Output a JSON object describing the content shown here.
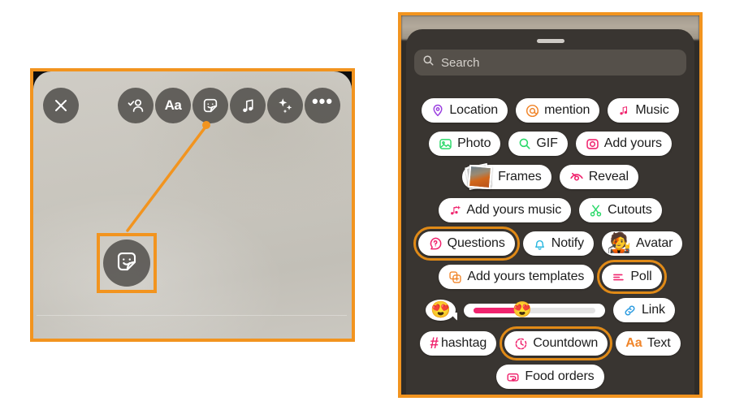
{
  "left_panel": {
    "name": "story-editor-screenshot",
    "toolbar": [
      {
        "id": "close",
        "icon": "close-icon",
        "label": "Close"
      },
      {
        "id": "tag",
        "icon": "tag-people-icon",
        "label": "Tag people"
      },
      {
        "id": "text",
        "icon": "text-icon",
        "label": "Aa"
      },
      {
        "id": "sticker",
        "icon": "sticker-icon",
        "label": "Stickers"
      },
      {
        "id": "music",
        "icon": "music-note-icon",
        "label": "Music"
      },
      {
        "id": "effects",
        "icon": "sparkles-icon",
        "label": "Effects"
      },
      {
        "id": "more",
        "icon": "more-options-icon",
        "label": "More"
      }
    ],
    "callout": {
      "name": "sticker-button-callout",
      "icon": "sticker-icon",
      "highlight_color": "#F2941F"
    }
  },
  "right_panel": {
    "name": "sticker-tray-sheet",
    "search": {
      "placeholder": "Search",
      "value": "",
      "icon": "search-icon"
    },
    "highlight_color": "#E08A17",
    "rows": [
      [
        {
          "label": "Location",
          "icon": "location-pin-icon",
          "icon_color": "#9B3FE0",
          "highlighted": false
        },
        {
          "label": "mention",
          "icon": "at-mention-icon",
          "icon_color": "#F0852A",
          "highlighted": false
        },
        {
          "label": "Music",
          "icon": "music-note-icon",
          "icon_color": "#F0246E",
          "highlighted": false
        }
      ],
      [
        {
          "label": "Photo",
          "icon": "photo-icon",
          "icon_color": "#2BD96A",
          "highlighted": false
        },
        {
          "label": "GIF",
          "icon": "gif-search-icon",
          "icon_color": "#2BD96A",
          "highlighted": false
        },
        {
          "label": "Add yours",
          "icon": "camera-icon",
          "icon_color": "#F0246E",
          "highlighted": false
        }
      ],
      [
        {
          "label": "Frames",
          "icon": "frames-photos-icon",
          "icon_color": "",
          "highlighted": false
        },
        {
          "label": "Reveal",
          "icon": "eye-slash-icon",
          "icon_color": "#F0246E",
          "highlighted": false
        }
      ],
      [
        {
          "label": "Add yours music",
          "icon": "music-plus-icon",
          "icon_color": "#F0246E",
          "highlighted": false
        },
        {
          "label": "Cutouts",
          "icon": "scissors-icon",
          "icon_color": "#2BD96A",
          "highlighted": false
        }
      ],
      [
        {
          "label": "Questions",
          "icon": "question-bubble-icon",
          "icon_color": "#F0246E",
          "highlighted": true
        },
        {
          "label": "Notify",
          "icon": "bell-icon",
          "icon_color": "#2BB8E0",
          "highlighted": false
        },
        {
          "label": "Avatar",
          "icon": "avatar-icon",
          "icon_color": "",
          "highlighted": false
        }
      ],
      [
        {
          "label": "Add yours templates",
          "icon": "templates-plus-icon",
          "icon_color": "#F0852A",
          "highlighted": false
        },
        {
          "label": "Poll",
          "icon": "poll-bars-icon",
          "icon_color": "#F0246E",
          "highlighted": true
        }
      ],
      [
        {
          "label": "",
          "icon": "emoji-reaction-icon",
          "icon_color": "",
          "highlighted": false
        },
        {
          "label": "",
          "icon": "emoji-slider-icon",
          "icon_color": "#F0246E",
          "highlighted": false
        },
        {
          "label": "Link",
          "icon": "link-icon",
          "icon_color": "#2B9BE0",
          "highlighted": false
        }
      ],
      [
        {
          "label": "hashtag",
          "icon": "hashtag-icon",
          "icon_color": "#F0246E",
          "highlighted": false
        },
        {
          "label": "Countdown",
          "icon": "countdown-clock-icon",
          "icon_color": "#F0246E",
          "highlighted": true
        },
        {
          "label": "Text",
          "icon": "text-aa-icon",
          "icon_color": "#F0852A",
          "highlighted": false
        }
      ],
      [
        {
          "label": "Food orders",
          "icon": "food-orders-icon",
          "icon_color": "#F0246E",
          "highlighted": false
        }
      ]
    ],
    "emoji": {
      "reaction": "😍",
      "slider_emoji": "😍",
      "slider_value": 40
    },
    "hashtag_symbol": "#"
  }
}
